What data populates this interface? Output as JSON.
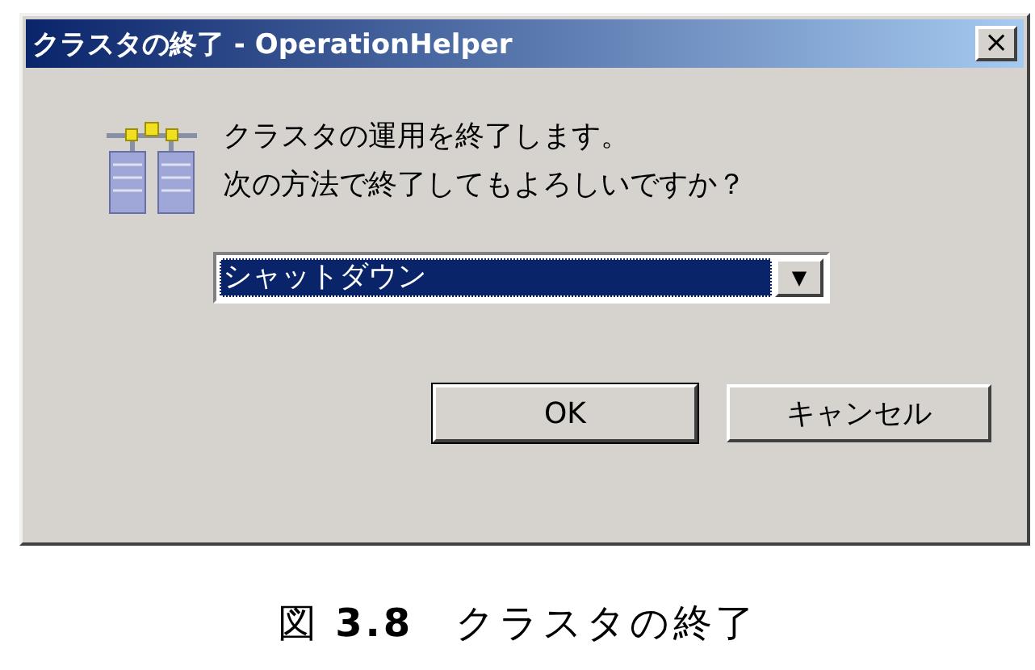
{
  "window": {
    "title": "クラスタの終了 - OperationHelper",
    "close_button": "×"
  },
  "message": [
    "クラスタの運用を終了します。",
    "次の方法で終了してもよろしいですか？"
  ],
  "dropdown": {
    "value": "シャットダウン",
    "arrow": "▼",
    "selected": true
  },
  "buttons": [
    {
      "label": "OK",
      "default": true
    },
    {
      "label": "キャンセル",
      "default": false
    }
  ],
  "caption": "図 **3.8**　クラスタの終了"
}
